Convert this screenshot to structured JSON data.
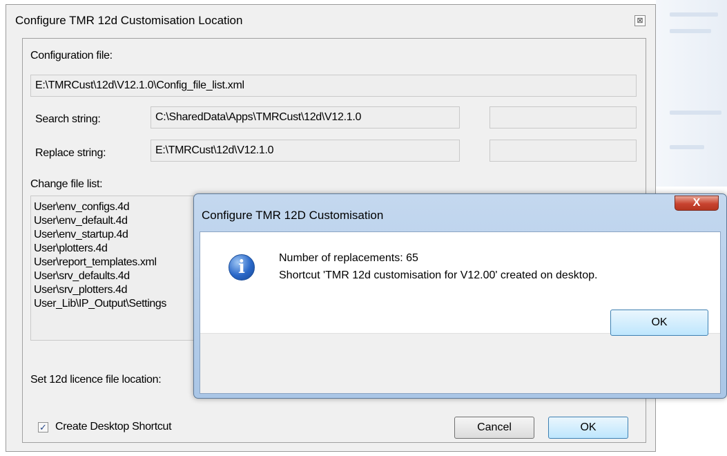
{
  "main_dialog": {
    "title": "Configure  TMR 12d Customisation Location",
    "close_glyph": "⊠",
    "config_label": "Configuration file:",
    "config_value": "E:\\TMRCust\\12d\\V12.1.0\\Config_file_list.xml",
    "search_label": "Search string:",
    "search_value": "C:\\SharedData\\Apps\\TMRCust\\12d\\V12.1.0",
    "replace_label": "Replace string:",
    "replace_value": "E:\\TMRCust\\12d\\V12.1.0",
    "change_list_label": "Change file list:",
    "change_list": [
      "User\\env_configs.4d",
      "User\\env_default.4d",
      "User\\env_startup.4d",
      "User\\plotters.4d",
      "User\\report_templates.xml",
      "User\\srv_defaults.4d",
      "User\\srv_plotters.4d",
      "User_Lib\\IP_Output\\Settings"
    ],
    "licence_label": "Set 12d licence file location:",
    "shortcut_label": "Create Desktop Shortcut",
    "shortcut_checked": "✓",
    "cancel_label": "Cancel",
    "ok_label": "OK"
  },
  "popup": {
    "title": "Configure TMR 12D Customisation",
    "close_glyph": "X",
    "icon": "info-icon",
    "icon_glyph": "i",
    "line1": "Number of replacements: 65",
    "line2": "Shortcut 'TMR 12d customisation for V12.00' created on desktop.",
    "ok_label": "OK"
  },
  "colors": {
    "dialog_bg": "#f0f0f0",
    "popup_frame": "#aac6e6",
    "close_red": "#c8432f",
    "default_button": "#bee6fd"
  }
}
